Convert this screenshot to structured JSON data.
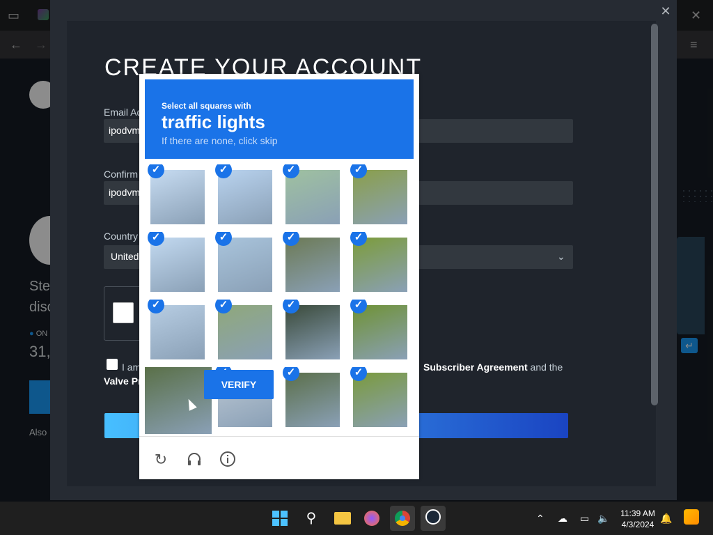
{
  "browser": {
    "icons": [
      "tabs-icon",
      "close-icon",
      "back-icon",
      "forward-icon",
      "menu-icon"
    ]
  },
  "background_page": {
    "text_fragment_1": "Ste",
    "text_fragment_2": "disc",
    "online_label": "ON",
    "online_count": "31,",
    "also_label": "Also"
  },
  "modal": {
    "title": "CREATE YOUR ACCOUNT",
    "email_label": "Email Ad",
    "email_value": "ipodvm",
    "confirm_label": "Confirm",
    "confirm_value": "ipodvm",
    "country_label": "Country",
    "country_value": "United",
    "agree_prefix": "I am",
    "agree_suffix_link": "Subscriber Agreement",
    "agree_suffix_end": "and the",
    "valve_label": "Valve Pr"
  },
  "captcha": {
    "instruction": "Select all squares with",
    "target": "traffic lights",
    "hint": "If there are none, click skip",
    "verify_label": "VERIFY",
    "footer_icons": [
      "reload-icon",
      "headphones-icon",
      "info-icon"
    ],
    "grid_selected": [
      [
        true,
        true,
        true,
        true
      ],
      [
        true,
        true,
        true,
        true
      ],
      [
        true,
        true,
        true,
        true
      ],
      [
        false,
        true,
        true,
        true
      ]
    ],
    "check_glyph": "✓"
  },
  "taskbar": {
    "apps": [
      "windows-start",
      "search",
      "file-explorer",
      "firefox",
      "chrome",
      "steam"
    ],
    "time": "11:39 AM",
    "date": "4/3/2024"
  },
  "colors": {
    "captcha_blue": "#1a73e8",
    "steam_blue": "#1a9fff",
    "modal_bg": "#262b33"
  }
}
